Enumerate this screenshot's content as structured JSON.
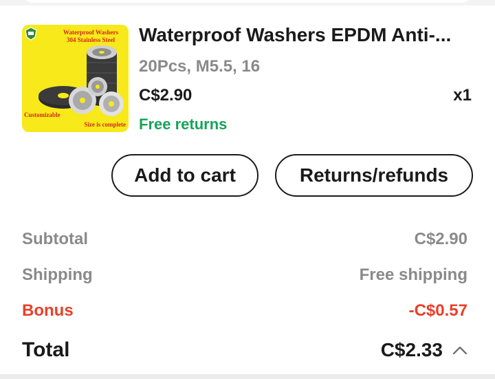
{
  "product": {
    "title": "Waterproof Washers EPDM Anti-...",
    "variant": "20Pcs, M5.5, 16",
    "price": "C$2.90",
    "quantity": "x1",
    "free_returns": "Free returns",
    "thumbnail": {
      "headline_line1": "Waterproof Washers",
      "headline_line2": "304 Stainless Steel",
      "customizable": "Customizable",
      "size_note": "Size is complete"
    }
  },
  "actions": {
    "add_to_cart": "Add to cart",
    "returns_refunds": "Returns/refunds"
  },
  "summary": {
    "subtotal_label": "Subtotal",
    "subtotal_value": "C$2.90",
    "shipping_label": "Shipping",
    "shipping_value": "Free shipping",
    "bonus_label": "Bonus",
    "bonus_value": "-C$0.57",
    "total_label": "Total",
    "total_value": "C$2.33"
  },
  "icons": {
    "collapse": "chevron-up-icon",
    "store_logo": "shield-logo-icon"
  },
  "colors": {
    "green": "#16a35a",
    "red": "#e8402a",
    "muted": "#8a8a8a",
    "thumb_bg": "#f7e91a"
  }
}
